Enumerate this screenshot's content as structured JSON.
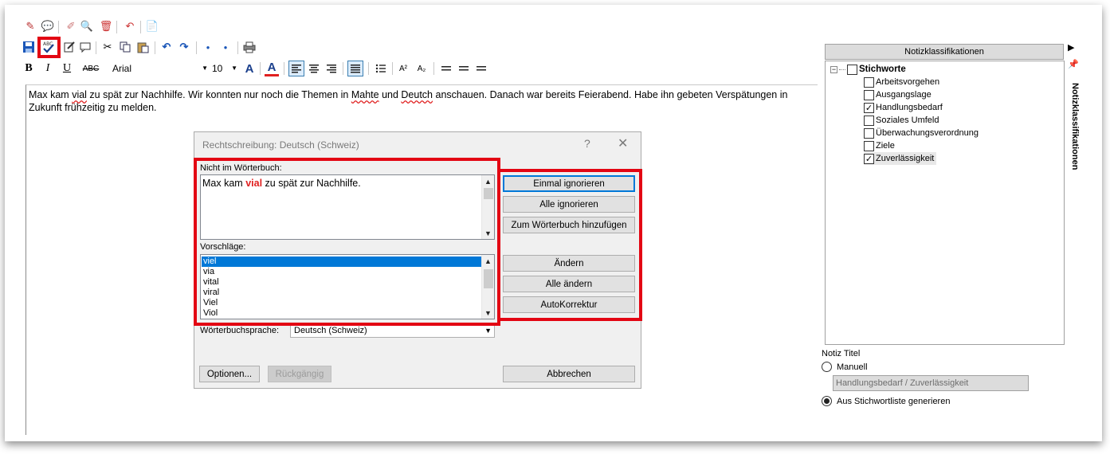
{
  "toolbar": {
    "font_name": "Arial",
    "font_size": "10",
    "bold_label": "B",
    "italic_label": "I",
    "underline_label": "U",
    "strike_label": "ABC",
    "superscript_label": "A²",
    "subscript_label": "A₂",
    "spellcheck_icon_text": "ABC"
  },
  "editor": {
    "parts": [
      "Max kam ",
      "vial",
      " zu spät zur Nachhilfe. Wir konnten nur noch die Themen in ",
      "Mahte",
      " und ",
      "Deutch",
      " anschauen. Danach war bereits Feierabend. Habe ihn gebeten Verspätungen in Zukunft frühzeitig zu melden."
    ]
  },
  "dialog": {
    "title": "Rechtschreibung: Deutsch (Schweiz)",
    "help": "?",
    "close": "✕",
    "not_in_dict_label": "Nicht im Wörterbuch:",
    "sentence_before": "Max kam ",
    "sentence_error": "vial",
    "sentence_after": " zu spät zur Nachhilfe.",
    "suggestions_label": "Vorschläge:",
    "suggestions": [
      "viel",
      "via",
      "vital",
      "viral",
      "Viel",
      "Viol"
    ],
    "dict_language_label": "Wörterbuchsprache:",
    "dict_language_value": "Deutsch (Schweiz)",
    "buttons": {
      "ignore_once": "Einmal ignorieren",
      "ignore_all": "Alle ignorieren",
      "add_to_dict": "Zum Wörterbuch hinzufügen",
      "change": "Ändern",
      "change_all": "Alle ändern",
      "autocorrect": "AutoKorrektur",
      "options": "Optionen...",
      "undo": "Rückgängig",
      "cancel": "Abbrechen"
    }
  },
  "right_panel": {
    "header": "Notizklassifikationen",
    "side_tab_label": "Notizklassifikationen",
    "tree_root": "Stichworte",
    "items": [
      {
        "label": "Arbeitsvorgehen",
        "checked": false
      },
      {
        "label": "Ausgangslage",
        "checked": false
      },
      {
        "label": "Handlungsbedarf",
        "checked": true
      },
      {
        "label": "Soziales Umfeld",
        "checked": false
      },
      {
        "label": "Überwachungsverordnung",
        "checked": false
      },
      {
        "label": "Ziele",
        "checked": false
      },
      {
        "label": "Zuverlässigkeit",
        "checked": true
      }
    ],
    "title_section_label": "Notiz Titel",
    "radio_manual": "Manuell",
    "title_value": "Handlungsbedarf / Zuverlässigkeit",
    "radio_generate": "Aus Stichwortliste generieren"
  },
  "colors": {
    "highlight_red": "#e30613",
    "selection_blue": "#0078d7",
    "error_text_red": "#e02020"
  }
}
